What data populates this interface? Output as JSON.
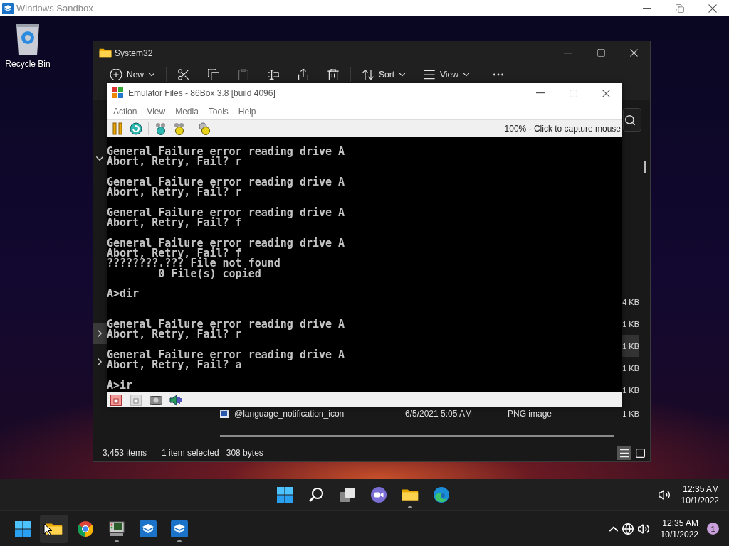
{
  "sandbox_window": {
    "title": "Windows Sandbox"
  },
  "desktop_icons": [
    {
      "label": "Recycle Bin"
    }
  ],
  "explorer": {
    "title": "System32",
    "toolbar": [
      {
        "kind": "new",
        "label": "New",
        "disabled": false
      },
      {
        "kind": "cut",
        "disabled": false
      },
      {
        "kind": "copy",
        "disabled": false
      },
      {
        "kind": "paste",
        "disabled": true
      },
      {
        "kind": "rename",
        "disabled": false
      },
      {
        "kind": "share",
        "disabled": false
      },
      {
        "kind": "delete",
        "disabled": false
      },
      {
        "kind": "sort",
        "label": "Sort",
        "disabled": false
      },
      {
        "kind": "view",
        "label": "View",
        "disabled": false
      },
      {
        "kind": "more",
        "disabled": false
      }
    ],
    "nav_items": [
      {
        "expanded": true,
        "hovered": false
      },
      {
        "expanded": false,
        "hovered": true
      },
      {
        "expanded": false,
        "hovered": false
      }
    ],
    "files": [
      {
        "size": "4 KB",
        "selected": false
      },
      {
        "size": "1 KB",
        "selected": false
      },
      {
        "size": "1 KB",
        "selected": true
      },
      {
        "size": "1 KB",
        "selected": false
      },
      {
        "size": "1 KB",
        "selected": false
      },
      {
        "name": "@language_notification_icon",
        "modified": "6/5/2021 5:05 AM",
        "type": "PNG image",
        "size": "1 KB",
        "selected": false
      }
    ],
    "status_bar": {
      "item_count": "3,453 items",
      "selection": "1 item selected",
      "selection_size": "308 bytes"
    },
    "view_modes": [
      {
        "kind": "details",
        "selected": true
      },
      {
        "kind": "tiles",
        "selected": false
      }
    ]
  },
  "emulator": {
    "title": "Emulator Files - 86Box 3.8 [build 4096]",
    "menu": [
      "Action",
      "View",
      "Media",
      "Tools",
      "Help"
    ],
    "toolbar_groups": [
      [
        {
          "kind": "pause"
        },
        {
          "kind": "reset"
        }
      ],
      [
        {
          "kind": "send-cad"
        },
        {
          "kind": "send-cae"
        }
      ],
      [
        {
          "kind": "settings"
        }
      ]
    ],
    "capture_hint": "100% - Click to capture mouse",
    "console": "General Failure error reading drive A\nAbort, Retry, Fail? r\n\nGeneral Failure error reading drive A\nAbort, Retry, Fail? r\n\nGeneral Failure error reading drive A\nAbort, Retry, Fail? f\n\nGeneral Failure error reading drive A\nAbort, Retry, Fail? f\n????????.??? File not found\n        0 File(s) copied\n\nA>dir\n\n\nGeneral Failure error reading drive A\nAbort, Retry, Fail? r\n\nGeneral Failure error reading drive A\nAbort, Retry, Fail? a\n\nA>ir",
    "status_icons": [
      {
        "kind": "floppy-active"
      },
      {
        "kind": "floppy"
      },
      {
        "kind": "cdrom"
      },
      {
        "kind": "sound"
      }
    ]
  },
  "inner_taskbar": {
    "apps": [
      {
        "kind": "start",
        "running": false
      },
      {
        "kind": "search",
        "running": false
      },
      {
        "kind": "task-view",
        "running": false
      },
      {
        "kind": "chat",
        "running": false
      },
      {
        "kind": "explorer",
        "running": true
      },
      {
        "kind": "edge",
        "running": false
      }
    ],
    "tray": [
      {
        "kind": "volume"
      }
    ],
    "time": "12:35 AM",
    "date": "10/1/2022"
  },
  "host_taskbar": {
    "apps": [
      {
        "kind": "start",
        "running": false,
        "hovered": false
      },
      {
        "kind": "explorer",
        "running": false,
        "hovered": true
      },
      {
        "kind": "chrome",
        "running": false,
        "hovered": false
      },
      {
        "kind": "emulator",
        "running": true,
        "hovered": false
      },
      {
        "kind": "sandbox",
        "running": false,
        "hovered": false
      },
      {
        "kind": "sandbox",
        "running": true,
        "hovered": false
      }
    ],
    "tray": [
      {
        "kind": "chevron"
      },
      {
        "kind": "globe"
      },
      {
        "kind": "volume"
      }
    ],
    "time": "12:35 AM",
    "date": "10/1/2022",
    "notification_count": "1"
  }
}
